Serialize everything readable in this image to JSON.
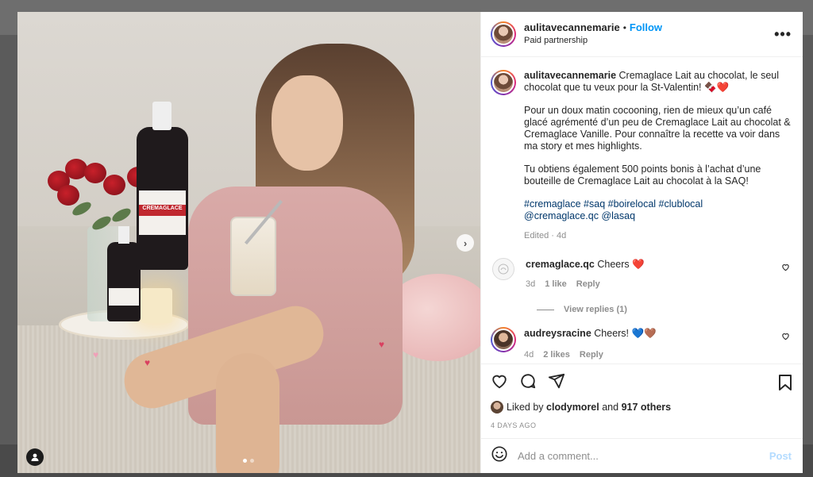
{
  "post": {
    "username": "aulitavecannemarie",
    "separator": "•",
    "follow_label": "Follow",
    "subtitle": "Paid partnership",
    "more_label": "•••"
  },
  "caption": {
    "username": "aulitavecannemarie",
    "line1": "Cremaglace Lait au chocolat, le seul chocolat que tu veux pour la St-Valentin! 🍫❤️",
    "para2": "Pour un doux matin cocooning, rien de mieux qu’un café glacé agrémenté d’un peu de Cremaglace Lait au chocolat & Cremaglace Vanille. Pour connaître la recette va voir dans ma story et mes highlights.",
    "para3": "Tu obtiens également 500 points bonis à l’achat d’une bouteille de Cremaglace Lait au chocolat à la SAQ!",
    "hashtags": "#cremaglace #saq #boirelocal #clublocal",
    "mentions": "@cremaglace.qc @lasaq",
    "edited": "Edited · 4d"
  },
  "comments": [
    {
      "username": "cremaglace.qc",
      "text": "Cheers ❤️",
      "time": "3d",
      "likes": "1 like",
      "reply": "Reply"
    },
    {
      "username": "audreysracine",
      "text": "Cheers! 💙🤎",
      "time": "4d",
      "likes": "2 likes",
      "reply": "Reply"
    }
  ],
  "view_replies": "View replies (1)",
  "likes": {
    "prefix": "Liked by",
    "user": "clodymorel",
    "middle": "and",
    "others": "917 others"
  },
  "timestamp": "4 DAYS AGO",
  "composer": {
    "placeholder": "Add a comment...",
    "post_label": "Post"
  },
  "media": {
    "arrow": "›",
    "slide_count": 2,
    "active_slide": 1,
    "bottle_label": "CREMAGLACE"
  },
  "colors": {
    "link_blue": "#0095f6",
    "hashtag_blue": "#00376b",
    "post_disabled": "#b3dbff"
  },
  "icons": [
    "heart-icon",
    "comment-icon",
    "share-icon",
    "bookmark-icon",
    "emoji-icon",
    "user-tag-icon",
    "next-arrow-icon"
  ]
}
